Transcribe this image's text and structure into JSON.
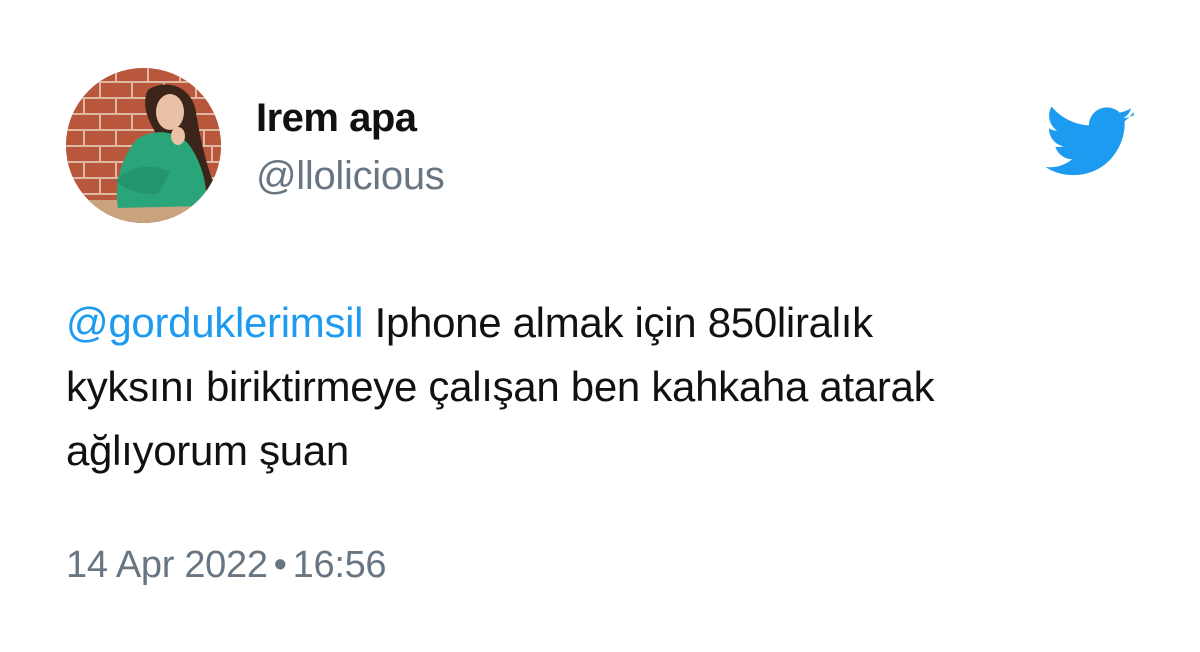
{
  "author": {
    "display_name": "Irem apa",
    "handle": "@llolicious"
  },
  "tweet": {
    "mention": "@gordukl​erimsil",
    "text_line1": " Iphone almak için 850liralık",
    "text_line2": "kyksını biriktirmeye çalışan ben kahkaha atarak",
    "text_line3": "ağlıyorum şuan",
    "date": "14 Apr 2022",
    "separator": "•",
    "time": "16:56"
  },
  "icons": {
    "brand": "twitter-bird-icon",
    "avatar": "avatar-photo"
  },
  "colors": {
    "brand": "#1d9bf0",
    "mention": "#1d9bf0",
    "secondary_text": "#687684",
    "primary_text": "#111111"
  }
}
